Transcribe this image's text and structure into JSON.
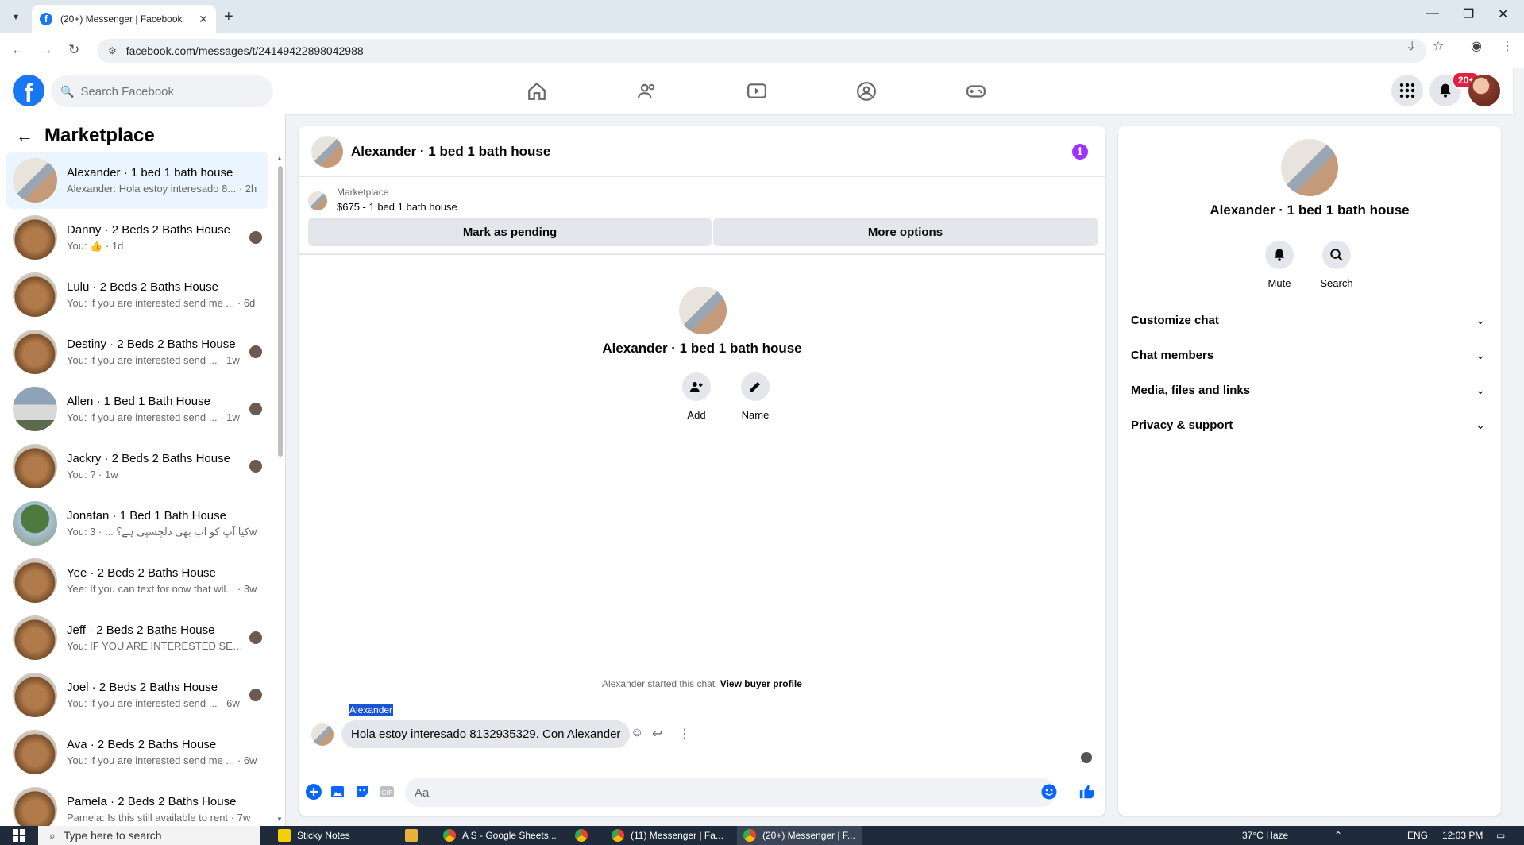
{
  "browser": {
    "tab_title": "(20+) Messenger | Facebook",
    "url": "facebook.com/messages/t/24149422898042988"
  },
  "fb": {
    "search_placeholder": "Search Facebook",
    "notifications_badge": "20+"
  },
  "sidebar": {
    "title": "Marketplace",
    "chats": [
      {
        "name": "Alexander · 1 bed 1 bath house",
        "preview": "Alexander: Hola estoy interesado 8...",
        "time": "· 2h",
        "thumb": "porch",
        "active": true
      },
      {
        "name": "Danny · 2 Beds 2 Baths House",
        "preview": "You: 👍",
        "time": "· 1d",
        "thumb": "room",
        "mini": true
      },
      {
        "name": "Lulu · 2 Beds 2 Baths House",
        "preview": "You: if you are interested send me ...",
        "time": "· 6d",
        "thumb": "room"
      },
      {
        "name": "Destiny · 2 Beds 2 Baths House",
        "preview": "You: if you are interested send ...",
        "time": "· 1w",
        "thumb": "room",
        "mini": true
      },
      {
        "name": "Allen · 1 Bed 1 Bath House",
        "preview": "You: if you are interested send ...",
        "time": "· 1w",
        "thumb": "house",
        "mini": true
      },
      {
        "name": "Jackry · 2 Beds 2 Baths House",
        "preview": "You: ?",
        "time": "· 1w",
        "thumb": "room",
        "mini": true
      },
      {
        "name": "Jonatan · 1 Bed 1 Bath House",
        "preview": "You: کیا آپ کو اب بھی دلچسپی ہے؟ ...",
        "time": "· 3w",
        "thumb": "tree"
      },
      {
        "name": "Yee · 2 Beds 2 Baths House",
        "preview": "Yee: If you can text for now that wil...",
        "time": "· 3w",
        "thumb": "room"
      },
      {
        "name": "Jeff · 2 Beds 2 Baths House",
        "preview": "You: IF YOU ARE INTERESTED SE...",
        "time": "· 3w",
        "thumb": "room",
        "mini": true
      },
      {
        "name": "Joel · 2 Beds 2 Baths House",
        "preview": "You: if you are interested send ...",
        "time": "· 6w",
        "thumb": "room",
        "mini": true
      },
      {
        "name": "Ava · 2 Beds 2 Baths House",
        "preview": "You: if you are interested send me ...",
        "time": "· 6w",
        "thumb": "room"
      },
      {
        "name": "Pamela · 2 Beds 2 Baths House",
        "preview": "Pamela: Is this still available to rent",
        "time": "· 7w",
        "thumb": "room"
      }
    ]
  },
  "chat": {
    "title": "Alexander · 1 bed 1 bath house",
    "marketplace_label": "Marketplace",
    "listing": "$675 - 1 bed 1 bath house",
    "mark_pending": "Mark as pending",
    "more_options": "More options",
    "intro_name": "Alexander · 1 bed 1 bath house",
    "add_label": "Add",
    "name_label": "Name",
    "started_text": "Alexander started this chat. ",
    "view_buyer": "View buyer profile",
    "sender": "Alexander",
    "message": "Hola estoy interesado 8132935329. Con Alexander",
    "composer_placeholder": "Aa"
  },
  "details": {
    "name": "Alexander · 1 bed 1 bath house",
    "mute": "Mute",
    "search": "Search",
    "sections": [
      "Customize chat",
      "Chat members",
      "Media, files and links",
      "Privacy & support"
    ]
  },
  "taskbar": {
    "search_placeholder": "Type here to search",
    "items": [
      "Sticky Notes",
      "A S - Google Sheets...",
      "(11) Messenger | Fa...",
      "(20+) Messenger | F..."
    ],
    "weather": "37°C  Haze",
    "lang": "ENG",
    "time": "12:03 PM"
  }
}
